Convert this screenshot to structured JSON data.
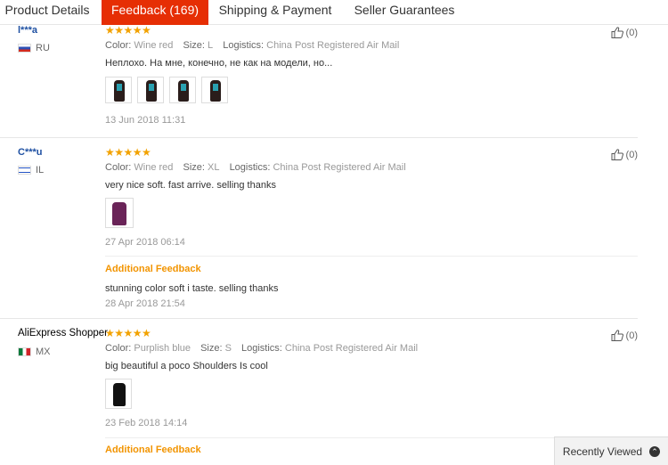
{
  "tabs": [
    {
      "label": "Product Details",
      "active": false
    },
    {
      "label": "Feedback (169)",
      "active": true
    },
    {
      "label": "Shipping & Payment",
      "active": false
    },
    {
      "label": "Seller Guarantees",
      "active": false
    }
  ],
  "labels": {
    "color": "Color:",
    "size": "Size:",
    "logistics": "Logistics:",
    "additional_feedback": "Additional Feedback",
    "stars": "★★★★★"
  },
  "reviews": [
    {
      "user": "l***a",
      "country": "RU",
      "rating": 5,
      "color": "Wine red",
      "size": "L",
      "logistics": "China Post Registered Air Mail",
      "text": "Неплохо. На мне, конечно, не как на модели, но...",
      "photos": 4,
      "date": "13 Jun 2018 11:31",
      "helpful": "(0)"
    },
    {
      "user": "C***u",
      "country": "IL",
      "rating": 5,
      "color": "Wine red",
      "size": "XL",
      "logistics": "China Post Registered Air Mail",
      "text": "very nice soft. fast arrive. selling thanks",
      "photos": 1,
      "date": "27 Apr 2018 06:14",
      "additional_text": "stunning color soft i taste. selling thanks",
      "additional_date": "28 Apr 2018 21:54",
      "helpful": "(0)"
    },
    {
      "user": "AliExpress Shopper",
      "country": "MX",
      "rating": 5,
      "color": "Purplish blue",
      "size": "S",
      "logistics": "China Post Registered Air Mail",
      "text": "big beautiful a poco Shoulders Is cool",
      "photos": 1,
      "date": "23 Feb 2018 14:14",
      "helpful": "(0)"
    }
  ],
  "recently_viewed": "Recently Viewed",
  "colors": {
    "active_tab": "#e62e04",
    "stars": "#f2a200",
    "additional_feedback": "#f29400",
    "username": "#1e50a2"
  }
}
